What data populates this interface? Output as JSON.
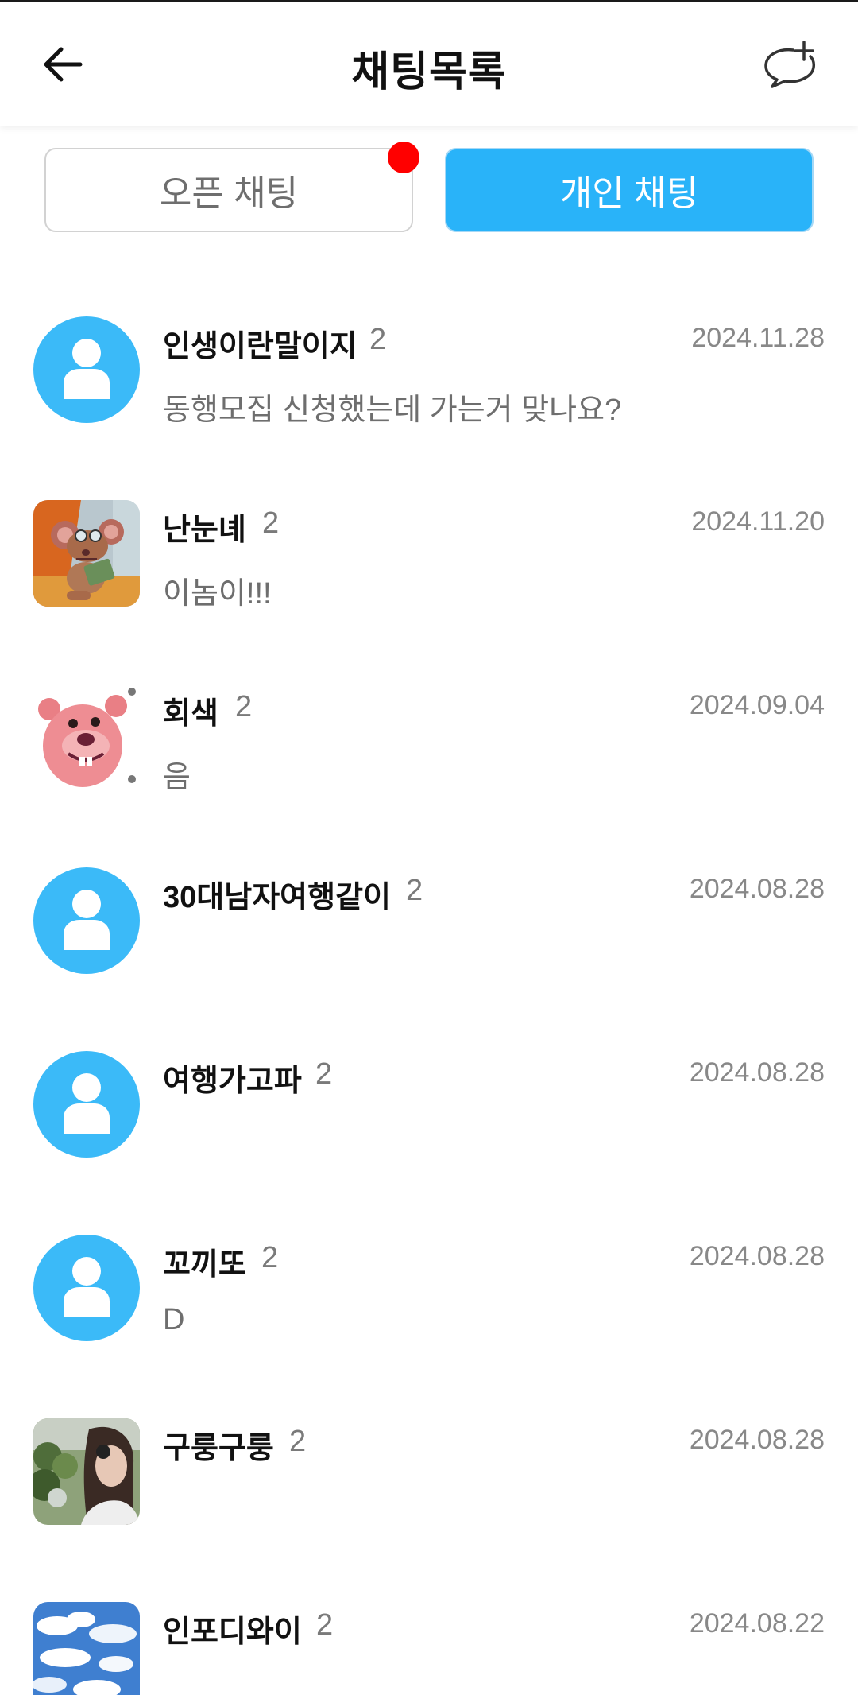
{
  "header": {
    "title": "채팅목록",
    "back_icon": "back-arrow-icon",
    "new_chat_icon": "new-chat-bubble-icon"
  },
  "tabs": [
    {
      "label": "오픈 채팅",
      "selected": false,
      "has_badge": true
    },
    {
      "label": "개인 채팅",
      "selected": true,
      "has_badge": false
    }
  ],
  "colors": {
    "accent": "#29b3f9",
    "default_avatar": "#3bbaf8",
    "badge": "#ff0000"
  },
  "chats": [
    {
      "name": "인생이란말이지",
      "count": "2",
      "date": "2024.11.28",
      "preview": "동행모집 신청했는데 가는거 맞나요?",
      "avatar": "default-avatar-icon"
    },
    {
      "name": "난눈녜",
      "count": "2",
      "date": "2024.11.20",
      "preview": "이놈이!!!",
      "avatar": "cartoon-mouse-avatar"
    },
    {
      "name": "회색",
      "count": "2",
      "date": "2024.09.04",
      "preview": "음",
      "avatar": "pink-beaver-avatar"
    },
    {
      "name": "30대남자여행같이",
      "count": "2",
      "date": "2024.08.28",
      "preview": "",
      "avatar": "default-avatar-icon"
    },
    {
      "name": "여행가고파",
      "count": "2",
      "date": "2024.08.28",
      "preview": "",
      "avatar": "default-avatar-icon"
    },
    {
      "name": "꼬끼또",
      "count": "2",
      "date": "2024.08.28",
      "preview": "D",
      "avatar": "default-avatar-icon"
    },
    {
      "name": "구룽구룽",
      "count": "2",
      "date": "2024.08.28",
      "preview": "",
      "avatar": "person-photo-avatar"
    },
    {
      "name": "인포디와이",
      "count": "2",
      "date": "2024.08.22",
      "preview": "",
      "avatar": "sky-clouds-avatar"
    }
  ]
}
